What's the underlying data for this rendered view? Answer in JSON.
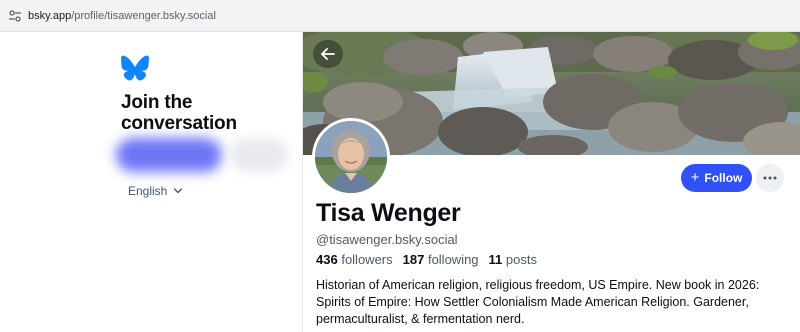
{
  "browser": {
    "url_host": "bsky.app",
    "url_path": "/profile/tisawenger.bsky.social"
  },
  "sidebar": {
    "heading": "Join the conversation",
    "language": "English"
  },
  "profile": {
    "display_name": "Tisa Wenger",
    "handle": "@tisawenger.bsky.social",
    "followers_count": "436",
    "followers_label": "followers",
    "following_count": "187",
    "following_label": "following",
    "posts_count": "11",
    "posts_label": "posts",
    "bio": "Historian of American religion, religious freedom, US Empire. New book in 2026: Spirits of Empire: How Settler Colonialism Made American Religion. Gardener, permaculturalist, & fermentation nerd.",
    "follow_label": "Follow",
    "follow_icon": "plus-icon"
  },
  "colors": {
    "brand": "#1185fe",
    "follow_button": "#2f51f5"
  }
}
